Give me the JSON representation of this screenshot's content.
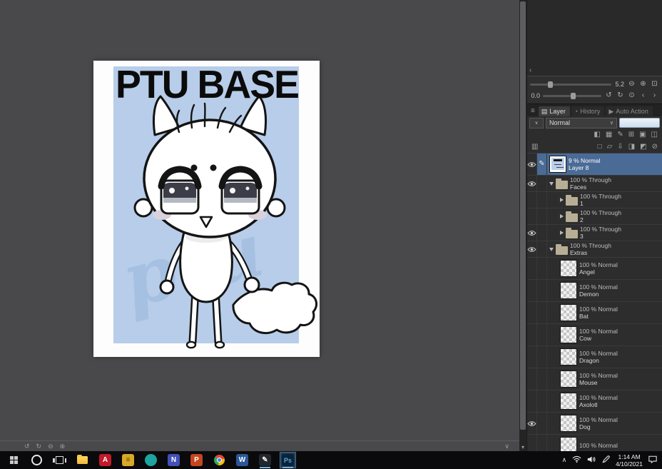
{
  "artwork": {
    "title": "PTU BASE",
    "watermark": "ptu",
    "background_color": "#b7cde9"
  },
  "navigator": {
    "zoom_value": "5.2",
    "rotation_value": "0.0",
    "zoom_icons": [
      "zoom-out",
      "zoom-in",
      "fit-screen"
    ],
    "rotation_icons": [
      "rotate-ccw",
      "rotate-cw",
      "reset-rotation",
      "prev-view",
      "next-view"
    ]
  },
  "layer_panel": {
    "tabs": [
      {
        "icon": "layers",
        "label": "Layer",
        "active": true
      },
      {
        "icon": "history",
        "label": "History",
        "active": false
      },
      {
        "icon": "auto-action",
        "label": "Auto Action",
        "active": false
      }
    ],
    "blend_mode": "Normal",
    "toolbar_row1_icons": [
      "lock-transparent",
      "halftone",
      "draft-layer",
      "grid",
      "reference",
      "divider-palette"
    ],
    "toolbar_row2_left_icon": "thumbnail-size",
    "toolbar_row2_icons": [
      "new-layer",
      "new-folder",
      "transfer-to-lower",
      "merge-to-lower",
      "layer-mask",
      "delete-layer"
    ],
    "layers": [
      {
        "opacity_label": "9 % Normal",
        "name": "Layer 8",
        "kind": "layer",
        "thumb": "artwork",
        "visible": true,
        "editing": true,
        "selected": true,
        "indent": 0
      },
      {
        "opacity_label": "100 % Through",
        "name": "Faces",
        "kind": "folder",
        "expanded": true,
        "visible": true,
        "indent": 0
      },
      {
        "opacity_label": "100 % Through",
        "name": "1",
        "kind": "folder",
        "expanded": false,
        "visible": false,
        "indent": 1
      },
      {
        "opacity_label": "100 % Through",
        "name": "2",
        "kind": "folder",
        "expanded": false,
        "visible": false,
        "indent": 1
      },
      {
        "opacity_label": "100 % Through",
        "name": "3",
        "kind": "folder",
        "expanded": false,
        "visible": true,
        "indent": 1
      },
      {
        "opacity_label": "100 % Through",
        "name": "Extras",
        "kind": "folder",
        "expanded": true,
        "visible": true,
        "indent": 0
      },
      {
        "opacity_label": "100 % Normal",
        "name": "Angel",
        "kind": "layer",
        "thumb": "checker",
        "visible": false,
        "indent": 1
      },
      {
        "opacity_label": "100 % Normal",
        "name": "Demon",
        "kind": "layer",
        "thumb": "checker",
        "visible": false,
        "indent": 1
      },
      {
        "opacity_label": "100 % Normal",
        "name": "Bat",
        "kind": "layer",
        "thumb": "checker",
        "visible": false,
        "indent": 1
      },
      {
        "opacity_label": "100 % Normal",
        "name": "Cow",
        "kind": "layer",
        "thumb": "checker",
        "visible": false,
        "indent": 1
      },
      {
        "opacity_label": "100 % Normal",
        "name": "Dragon",
        "kind": "layer",
        "thumb": "checker",
        "visible": false,
        "indent": 1
      },
      {
        "opacity_label": "100 % Normal",
        "name": "Mouse",
        "kind": "layer",
        "thumb": "checker",
        "visible": false,
        "indent": 1
      },
      {
        "opacity_label": "100 % Normal",
        "name": "Axolotl",
        "kind": "layer",
        "thumb": "checker",
        "visible": false,
        "indent": 1
      },
      {
        "opacity_label": "100 % Normal",
        "name": "Dog",
        "kind": "layer",
        "thumb": "checker",
        "visible": true,
        "indent": 1
      },
      {
        "opacity_label": "100 % Normal",
        "name": "",
        "kind": "layer",
        "thumb": "checker",
        "visible": false,
        "indent": 1
      }
    ]
  },
  "canvas_statusbar": {
    "left_icons": [
      "rotate-ccw",
      "rotate-cw",
      "zoom-out",
      "zoom-in"
    ],
    "right_icons": [
      "collapse-down"
    ]
  },
  "taskbar": {
    "apps": [
      {
        "name": "start"
      },
      {
        "name": "search"
      },
      {
        "name": "task-view"
      },
      {
        "name": "file-explorer"
      },
      {
        "name": "acrobat",
        "glyph": "A",
        "bg": "#c11a2b",
        "fg": "#ffffff"
      },
      {
        "name": "sticky-notes",
        "glyph": "≡",
        "bg": "#d8a827",
        "fg": "#5c4500"
      },
      {
        "name": "paint-app",
        "glyph": "",
        "bg": "#1fa3a0",
        "round": true
      },
      {
        "name": "onenote",
        "glyph": "N",
        "bg": "#4350b8",
        "fg": "#ffffff"
      },
      {
        "name": "powerpoint",
        "glyph": "P",
        "bg": "#c5451f",
        "fg": "#ffffff"
      },
      {
        "name": "chrome"
      },
      {
        "name": "word",
        "glyph": "W",
        "bg": "#2b5797",
        "fg": "#ffffff"
      },
      {
        "name": "clip-studio",
        "glyph": "✎",
        "bg": "#23262e",
        "fg": "#f0f0f0",
        "open": true
      },
      {
        "name": "photoshop",
        "glyph": "Ps",
        "bg": "#0b2334",
        "fg": "#52a8e8",
        "active": true,
        "open": true
      }
    ],
    "tray": {
      "clock_time": "1:14 AM",
      "clock_date": "4/10/2021"
    }
  }
}
